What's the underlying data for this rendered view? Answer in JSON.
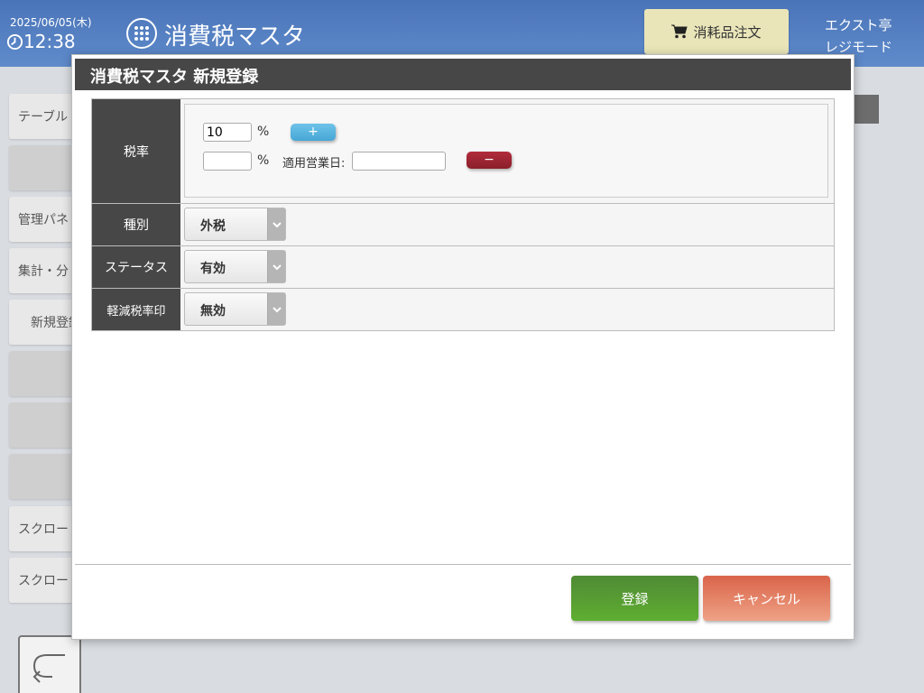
{
  "header": {
    "date": "2025/06/05(木)",
    "time": "12:38",
    "title": "消費税マスタ",
    "order_button": "消耗品注文",
    "shop_name": "エクスト亭",
    "mode": "レジモード",
    "bg_color": "#5079bd"
  },
  "sidebar": {
    "items": [
      {
        "label": "テーブル"
      },
      {
        "label": ""
      },
      {
        "label": "管理パネ"
      },
      {
        "label": "集計・分"
      },
      {
        "label": "新規登録"
      },
      {
        "label": ""
      },
      {
        "label": ""
      },
      {
        "label": ""
      },
      {
        "label": "スクロー"
      },
      {
        "label": "スクロー"
      }
    ]
  },
  "modal": {
    "title": "消費税マスタ 新規登録",
    "rate": {
      "label": "税率",
      "rate1_value": "10",
      "rate2_value": "",
      "percent": "%",
      "plus": "+",
      "minus": "−",
      "apply_date_label": "適用営業日:",
      "apply_date_value": ""
    },
    "type": {
      "label": "種別",
      "value": "外税"
    },
    "status": {
      "label": "ステータス",
      "value": "有効"
    },
    "reduced_mark": {
      "label": "軽減税率印",
      "value": "無効"
    },
    "register_button": "登録",
    "cancel_button": "キャンセル",
    "colors": {
      "register": "#56a033",
      "cancel": "#e47e62",
      "plus": "#56b3de",
      "minus": "#9e2533"
    }
  }
}
